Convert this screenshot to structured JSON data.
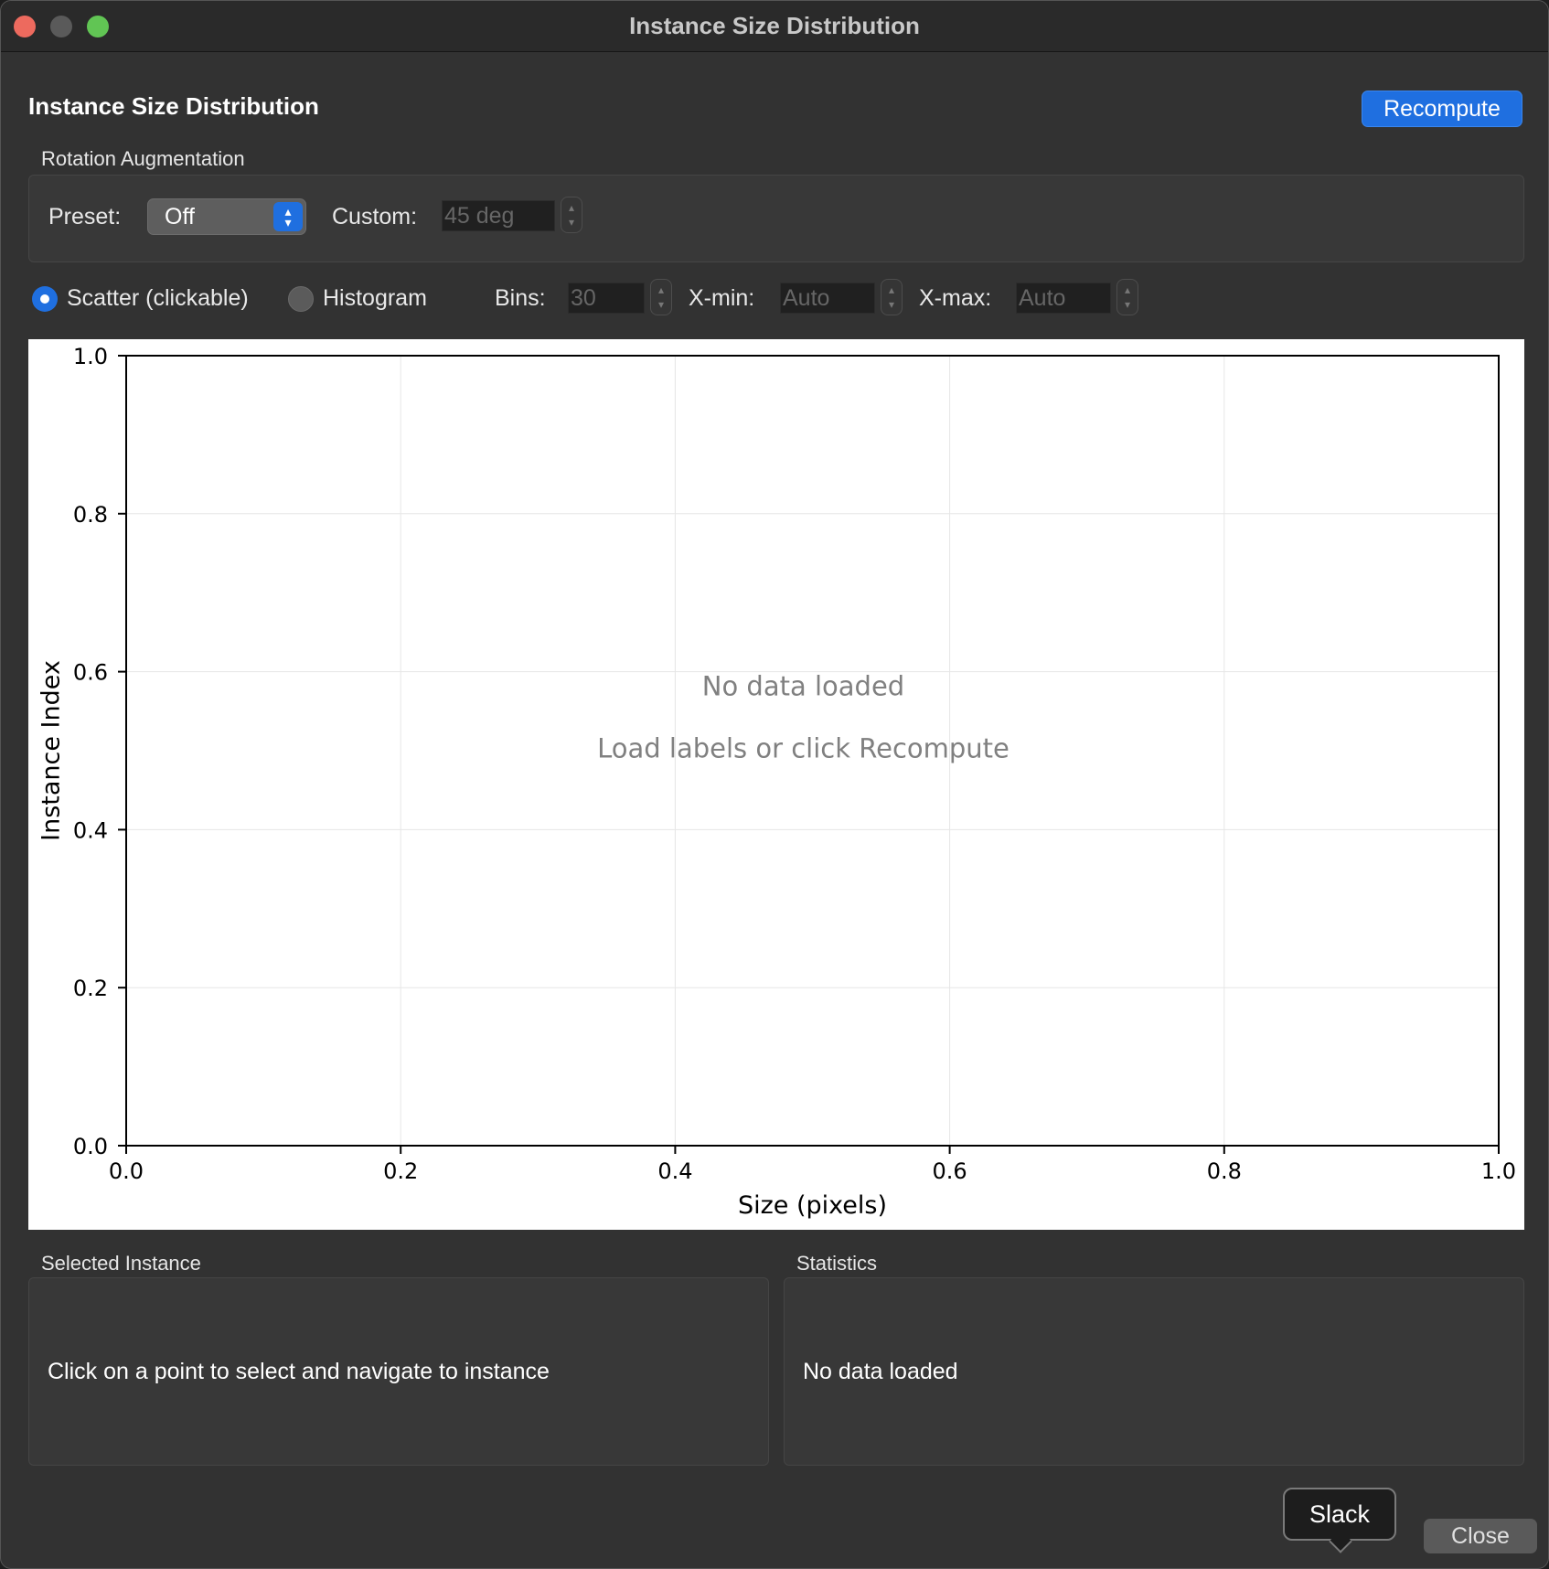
{
  "window": {
    "title": "Instance Size Distribution"
  },
  "header": {
    "title": "Instance Size Distribution",
    "recompute_label": "Recompute"
  },
  "rotation": {
    "group_label": "Rotation Augmentation",
    "preset_label": "Preset:",
    "preset_value": "Off",
    "custom_label": "Custom:",
    "custom_value": "45 deg"
  },
  "controls": {
    "scatter_label": "Scatter (clickable)",
    "scatter_selected": true,
    "histogram_label": "Histogram",
    "histogram_selected": false,
    "bins_label": "Bins:",
    "bins_value": "30",
    "xmin_label": "X-min:",
    "xmin_value": "Auto",
    "xmax_label": "X-max:",
    "xmax_value": "Auto"
  },
  "chart_data": {
    "type": "scatter",
    "series": [],
    "xlabel": "Size (pixels)",
    "ylabel": "Instance Index",
    "xlim": [
      0,
      1
    ],
    "ylim": [
      0,
      1
    ],
    "x_ticks": [
      "0.0",
      "0.2",
      "0.4",
      "0.6",
      "0.8",
      "1.0"
    ],
    "y_ticks": [
      "0.0",
      "0.2",
      "0.4",
      "0.6",
      "0.8",
      "1.0"
    ],
    "grid": true,
    "annotations": [
      "No data loaded",
      "Load labels or click Recompute"
    ]
  },
  "selected_instance": {
    "label": "Selected Instance",
    "message": "Click on a point to select and navigate to instance"
  },
  "statistics": {
    "label": "Statistics",
    "message": "No data loaded"
  },
  "footer": {
    "tooltip": "Slack",
    "close_label": "Close"
  }
}
